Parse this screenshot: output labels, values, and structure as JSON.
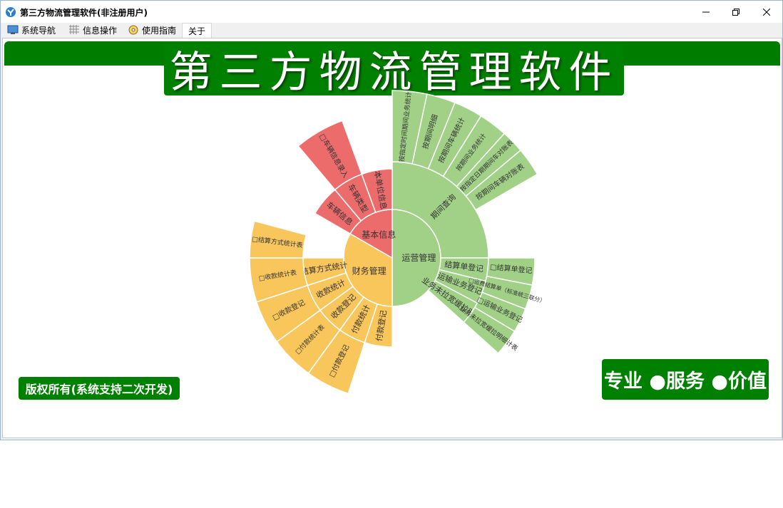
{
  "window": {
    "title": "第三方物流管理软件(非注册用户)",
    "minimize_icon": "minimize-icon",
    "maximize_icon": "restore-icon",
    "close_icon": "close-icon"
  },
  "menu": {
    "items": [
      {
        "label": "系统导航",
        "icon": "monitor-icon"
      },
      {
        "label": "信息操作",
        "icon": "grid-icon"
      },
      {
        "label": "使用指南",
        "icon": "compass-icon"
      },
      {
        "label": "关于",
        "icon": ""
      }
    ]
  },
  "banner": {
    "title": "第三方物流管理软件"
  },
  "footer": {
    "copyright": "版权所有(系统支持二次开发)",
    "slogan": "专业 ●服务 ●价值"
  },
  "colors": {
    "green": "#008000",
    "ops": "#a0d187",
    "finance": "#f9c65b",
    "basic": "#ec6c6c"
  },
  "sunburst": {
    "center": [
      {
        "label": "运营管理",
        "color": "#a0d187"
      },
      {
        "label": "财务管理",
        "color": "#f9c65b"
      },
      {
        "label": "基本信息",
        "color": "#ec6c6c"
      }
    ],
    "ring2": [
      {
        "label": "期间查询"
      },
      {
        "label": "结算单登记"
      },
      {
        "label": "运输业务登记"
      },
      {
        "label": "业务未拉宽缓拉明细"
      },
      {
        "label": "付款登记"
      },
      {
        "label": "付款统计"
      },
      {
        "label": "收款登记"
      },
      {
        "label": "收款统计"
      },
      {
        "label": "结算方式统计"
      },
      {
        "label": "车辆信息"
      },
      {
        "label": "车辆类型"
      },
      {
        "label": "本单位信息"
      }
    ],
    "ring3": [
      {
        "label": "按指定时间期间业务统计"
      },
      {
        "label": "按期间明细"
      },
      {
        "label": "按期间车辆统计"
      },
      {
        "label": "按期间业务统计"
      },
      {
        "label": "按指定日期期间车对账表"
      },
      {
        "label": "按期间车辆对账表"
      },
      {
        "label": "□结算单登记"
      },
      {
        "label": "□运费结算单（标准统三联分）"
      },
      {
        "label": "□运输业务登记"
      },
      {
        "label": "业务未拉宽缓拉明细计表"
      },
      {
        "label": "□付款登记"
      },
      {
        "label": "□付款统计表"
      },
      {
        "label": "□收款登记"
      },
      {
        "label": "□收款统计表"
      },
      {
        "label": "□结算方式统计表"
      },
      {
        "label": "□车辆信息录入"
      }
    ]
  }
}
